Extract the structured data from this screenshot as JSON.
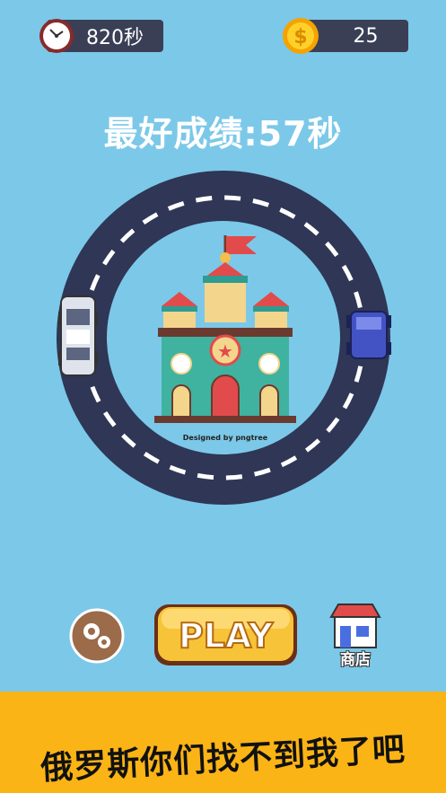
{
  "hud": {
    "time_value": "820秒",
    "coins_value": "25"
  },
  "best_score_text": "最好成绩:57秒",
  "castle": {
    "watermark": "Designed by pngtree"
  },
  "buttons": {
    "play_label": "PLAY",
    "shop_label": "商店"
  },
  "banner_text": "俄罗斯你们找不到我了吧",
  "colors": {
    "background": "#7cc8e8",
    "hud_bg": "#3a3f55",
    "track": "#2f3656",
    "banner": "#fbb415",
    "play_gold": "#f7c338"
  }
}
